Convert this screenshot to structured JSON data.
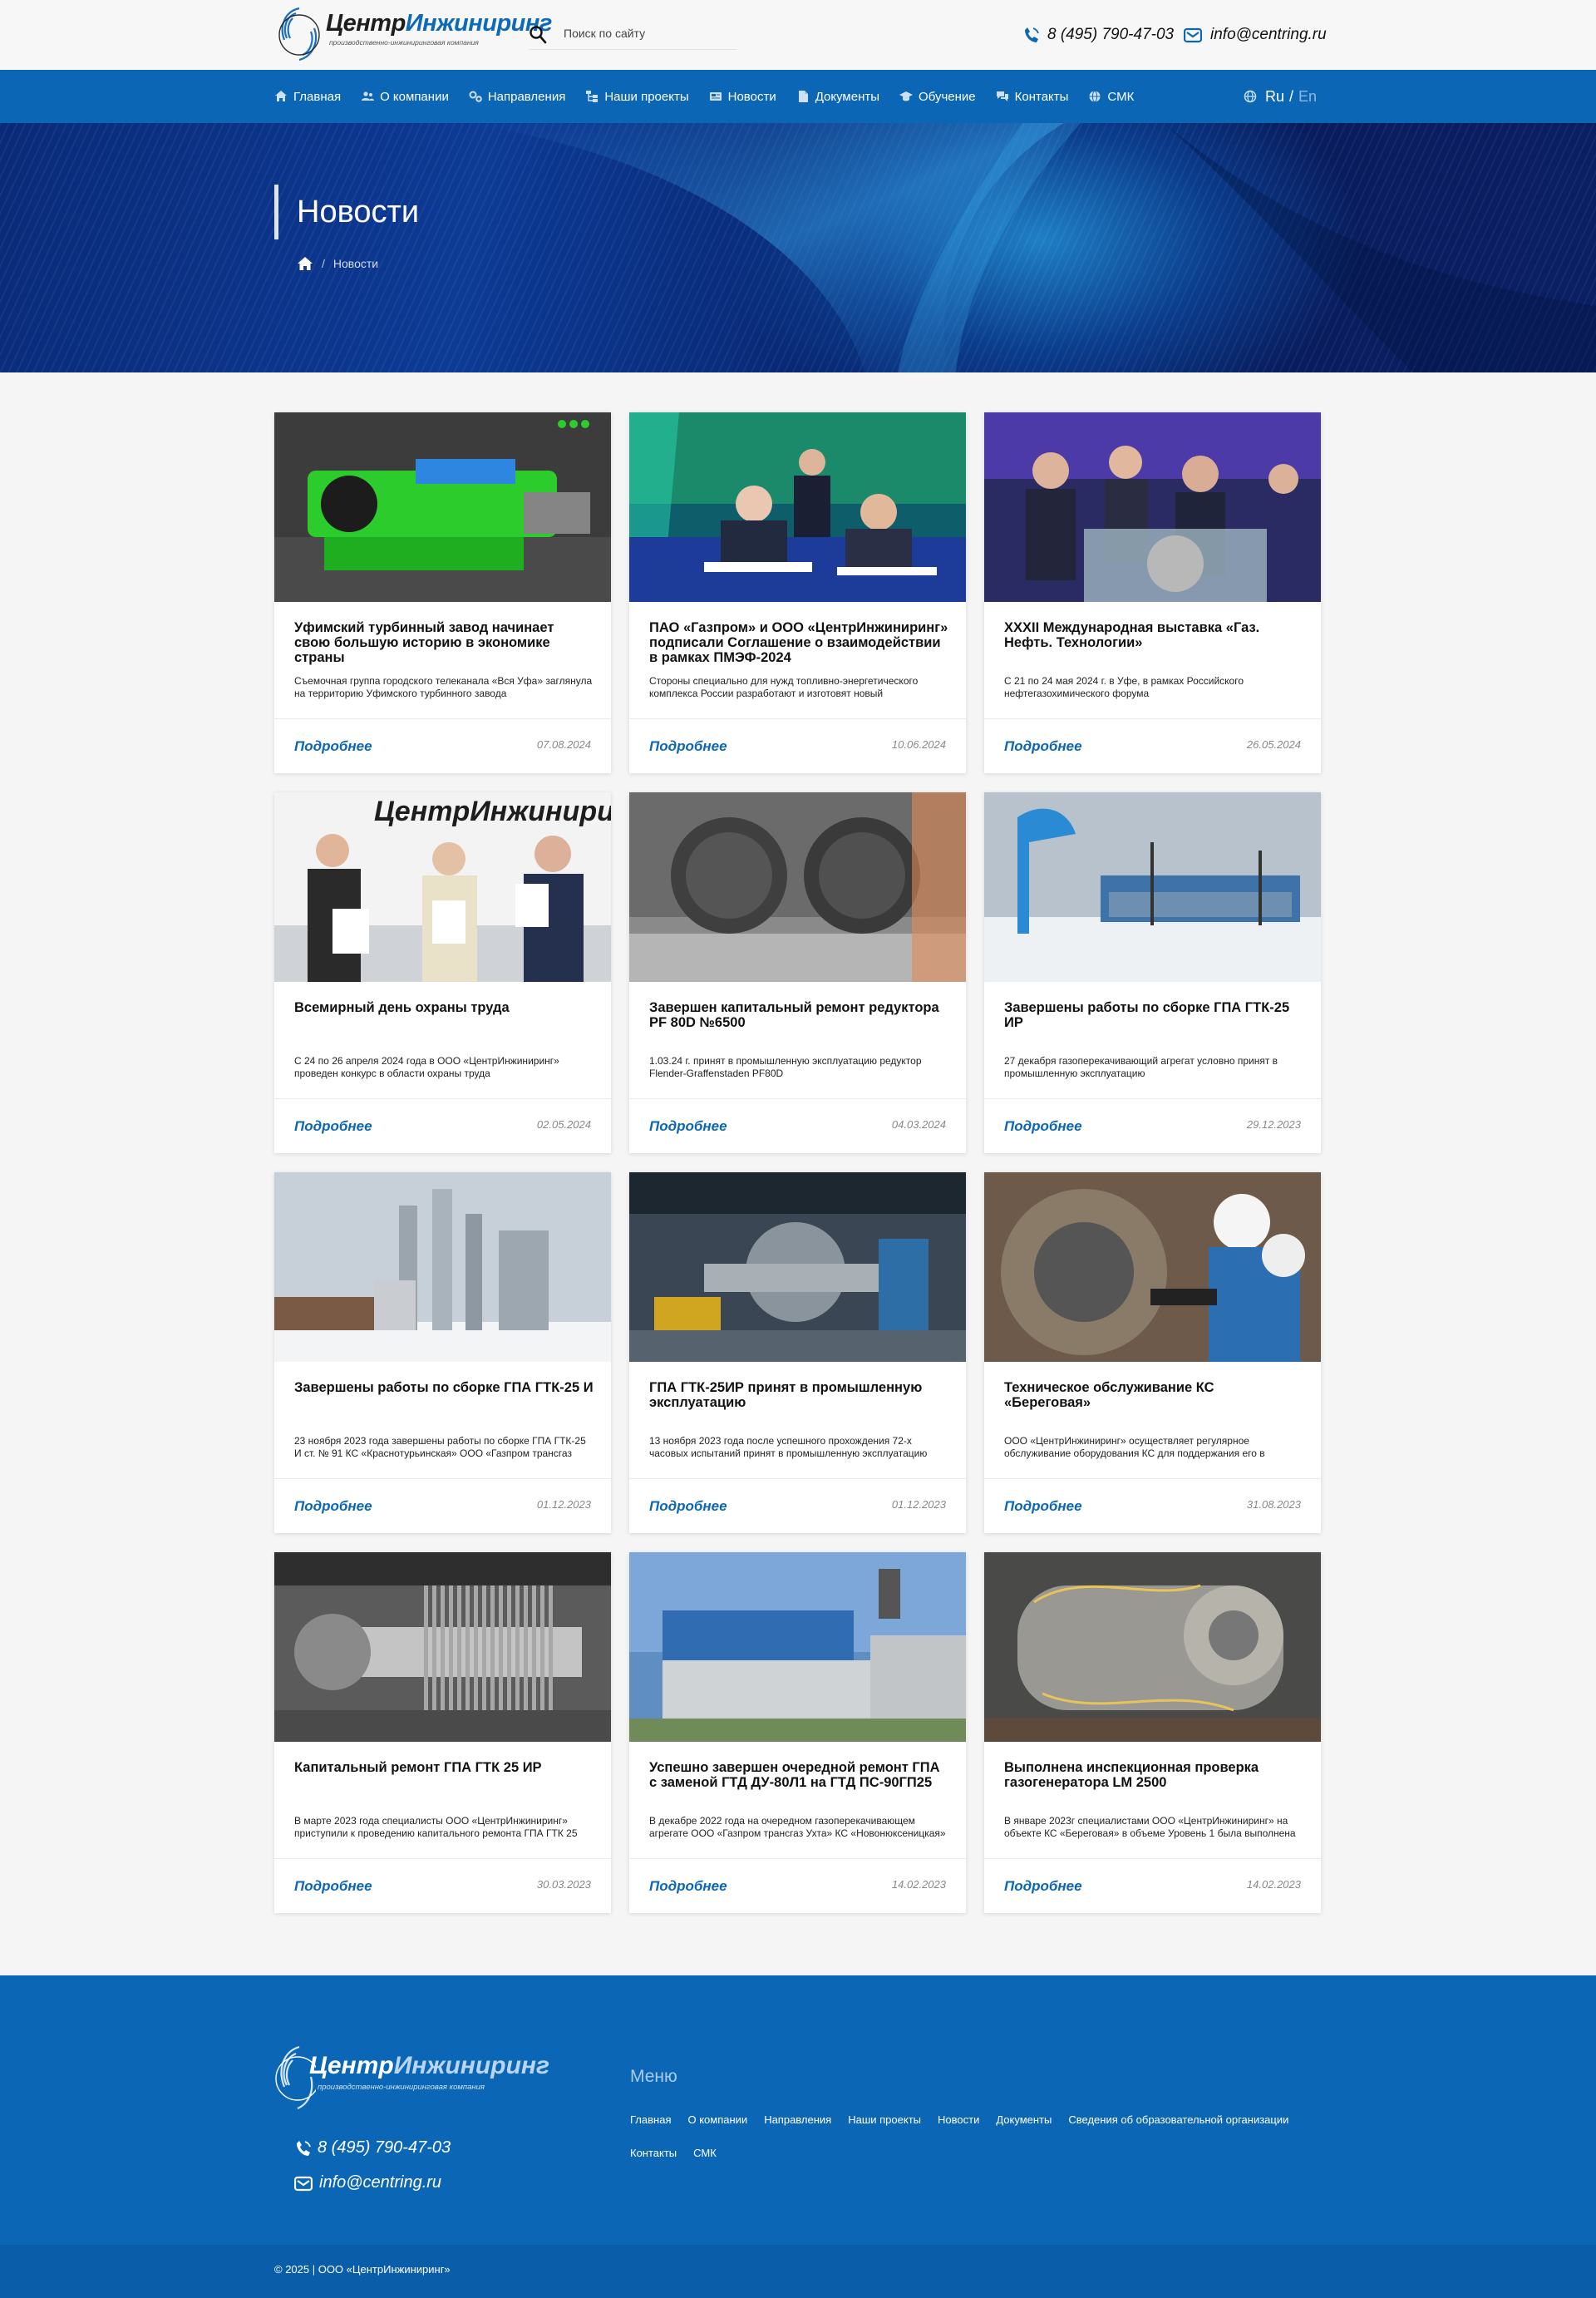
{
  "header": {
    "logo": {
      "part1": "Центр",
      "part2": "Инжиниринг",
      "tagline": "производственно-инжиниринговая компания"
    },
    "search": {
      "placeholder": "Поиск по сайту"
    },
    "phone": "8 (495) 790-47-03",
    "email": "info@centring.ru"
  },
  "nav": {
    "items": [
      {
        "label": "Главная",
        "icon": "home-icon"
      },
      {
        "label": "О компании",
        "icon": "users-icon"
      },
      {
        "label": "Направления",
        "icon": "gears-icon"
      },
      {
        "label": "Наши проекты",
        "icon": "sitemap-icon"
      },
      {
        "label": "Новости",
        "icon": "newspaper-icon"
      },
      {
        "label": "Документы",
        "icon": "document-icon"
      },
      {
        "label": "Обучение",
        "icon": "graduation-cap-icon"
      },
      {
        "label": "Контакты",
        "icon": "chat-icon"
      },
      {
        "label": "СМК",
        "icon": "globe-icon"
      }
    ],
    "lang": {
      "ru": "Ru",
      "sep": "/",
      "en": "En"
    }
  },
  "hero": {
    "title": "Новости",
    "breadcrumb": {
      "sep": "/",
      "current": "Новости"
    }
  },
  "cards": [
    {
      "title": "Уфимский турбинный завод начинает свою большую историю в экономике страны",
      "desc": "Съемочная группа городского телеканала «Вся Уфа» заглянула на территорию Уфимского турбинного завода",
      "more": "Подробнее",
      "date": "07.08.2024"
    },
    {
      "title": "ПАО «Газпром» и ООО «ЦентрИнжиниринг» подписали Соглашение о взаимодействии в рамках ПМЭФ-2024",
      "desc": "Стороны специально для нужд топливно-энергетического комплекса России разработают и изготовят новый",
      "more": "Подробнее",
      "date": "10.06.2024"
    },
    {
      "title": "XXXII Международная выставка «Газ. Нефть. Технологии»",
      "desc": "С 21 по 24 мая 2024 г. в Уфе, в рамках Российского нефтегазохимического форума",
      "more": "Подробнее",
      "date": "26.05.2024"
    },
    {
      "title": "Всемирный день охраны труда",
      "desc": "С 24 по 26 апреля 2024 года в ООО «ЦентрИнжиниринг» проведен конкурс в области охраны труда",
      "more": "Подробнее",
      "date": "02.05.2024"
    },
    {
      "title": "Завершен капитальный ремонт редуктора PF 80D №6500",
      "desc": "1.03.24 г. принят в промышленную эксплуатацию редуктор Flender-Graffenstaden PF80D",
      "more": "Подробнее",
      "date": "04.03.2024"
    },
    {
      "title": "Завершены работы по сборке ГПА ГТК-25 ИР",
      "desc": "27 декабря газоперекачивающий агрегат условно принят в промышленную эксплуатацию",
      "more": "Подробнее",
      "date": "29.12.2023"
    },
    {
      "title": "Завершены работы по сборке ГПА ГТК-25 И",
      "desc": "23 ноября 2023 года завершены работы по сборке ГПА ГТК-25 И ст. № 91 КС «Краснотурьинская» ООО «Газпром трансгаз",
      "more": "Подробнее",
      "date": "01.12.2023"
    },
    {
      "title": "ГПА ГТК-25ИР принят в промышленную эксплуатацию",
      "desc": "13 ноября 2023 года после успешного прохождения 72-х часовых испытаний принят в промышленную эксплуатацию",
      "more": "Подробнее",
      "date": "01.12.2023"
    },
    {
      "title": "Техническое обслуживание КС «Береговая»",
      "desc": "ООО «ЦентрИнжиниринг» осуществляет регулярное обслуживание оборудования КС для поддержания его в",
      "more": "Подробнее",
      "date": "31.08.2023"
    },
    {
      "title": "Капитальный ремонт ГПА ГТК 25 ИР",
      "desc": "В марте 2023 года специалисты ООО «ЦентрИнжиниринг» приступили к проведению капитального ремонта ГПА ГТК 25",
      "more": "Подробнее",
      "date": "30.03.2023"
    },
    {
      "title": "Успешно завершен очередной ремонт ГПА с заменой ГТД ДУ-80Л1 на ГТД ПС-90ГП25",
      "desc": "В декабре 2022 года на очередном газоперекачивающем агрегате ООО «Газпром трансгаз Ухта» КС «Новонюксеницкая»",
      "more": "Подробнее",
      "date": "14.02.2023"
    },
    {
      "title": "Выполнена инспекционная проверка газогенератора LM 2500",
      "desc": "В январе 2023г специалистами ООО «ЦентрИнжиниринг» на объекте КС «Береговая» в объеме Уровень 1 была выполнена",
      "more": "Подробнее",
      "date": "14.02.2023"
    }
  ],
  "footer": {
    "logo": {
      "part1": "Центр",
      "part2": "Инжиниринг",
      "tagline": "производственно-инжиниринговая компания"
    },
    "phone": "8 (495) 790-47-03",
    "email": "info@centring.ru",
    "menu_title": "Меню",
    "menu": [
      "Главная",
      "О компании",
      "Направления",
      "Наши проекты",
      "Новости",
      "Документы",
      "Сведения об образовательной организации",
      "Контакты",
      "СМК"
    ],
    "copyright": "© 2025 | ООО «ЦентрИнжиниринг»"
  },
  "colors": {
    "brand_blue": "#0b67b6",
    "hero_dark": "#0a2a78"
  }
}
